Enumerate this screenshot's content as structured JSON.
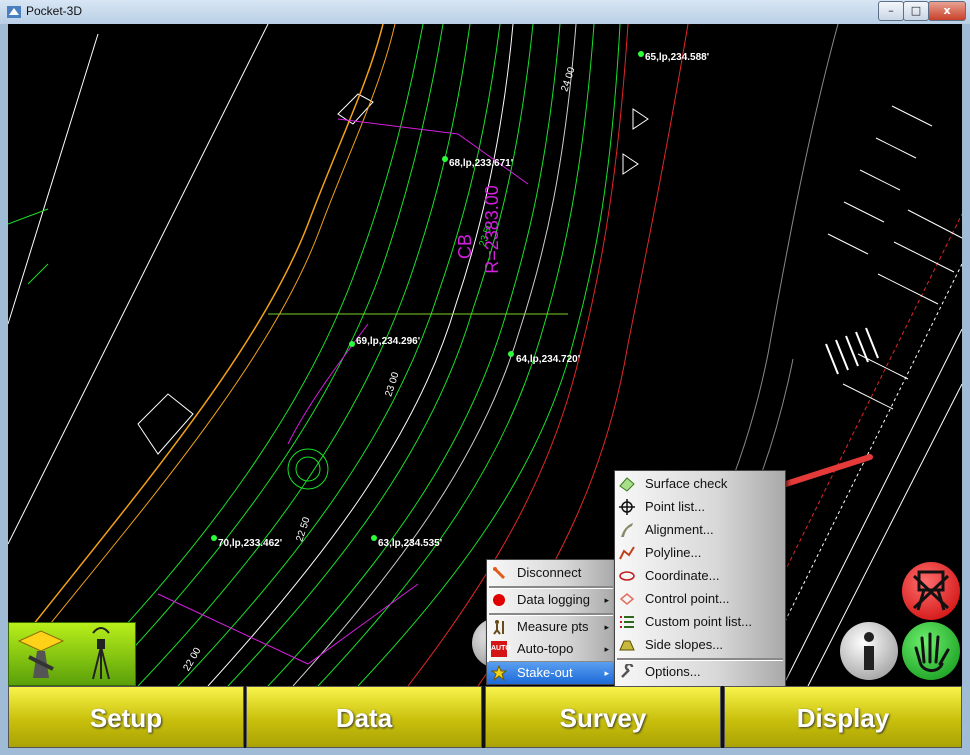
{
  "window": {
    "title": "Pocket-3D",
    "caption_min": "–",
    "caption_max": "□",
    "caption_close": "x"
  },
  "map": {
    "points": [
      "65,lp,234.588'",
      "68,lp,233.671'",
      "69,lp,234.296'",
      "64,lp,234.720'",
      "70,lp,233.462'",
      "63,lp,234.535'"
    ],
    "stations": [
      "24 00",
      "23 50",
      "23 00",
      "22 50",
      "22 00"
    ],
    "curve_label_1": "CB",
    "curve_label_2": "R=2383.00"
  },
  "survey_menu": {
    "items": [
      {
        "label": "Disconnect",
        "icon": "disconnect-icon",
        "submenu": false
      },
      {
        "label": "Data logging",
        "icon": "red-dot-icon",
        "submenu": true
      },
      {
        "label": "Measure pts",
        "icon": "surveyor-icon",
        "submenu": true
      },
      {
        "label": "Auto-topo",
        "icon": "auto-icon",
        "submenu": true
      },
      {
        "label": "Stake-out",
        "icon": "stakeout-icon",
        "submenu": true,
        "selected": true
      }
    ],
    "auto_badge": "AUTO",
    "arrow": "▸"
  },
  "stakeout_menu": {
    "items": [
      {
        "label": "Surface check",
        "icon": "surface-icon"
      },
      {
        "label": "Point list...",
        "icon": "crosshair-icon"
      },
      {
        "label": "Alignment...",
        "icon": "alignment-icon"
      },
      {
        "label": "Polyline...",
        "icon": "polyline-icon"
      },
      {
        "label": "Coordinate...",
        "icon": "coordinate-icon"
      },
      {
        "label": "Control point...",
        "icon": "control-point-icon"
      },
      {
        "label": "Custom point list...",
        "icon": "custom-list-icon"
      },
      {
        "label": "Side slopes...",
        "icon": "side-slopes-icon"
      },
      {
        "label": "Options...",
        "icon": "wrench-icon"
      }
    ]
  },
  "nav": {
    "setup": "Setup",
    "data": "Data",
    "survey": "Survey",
    "display": "Display"
  },
  "colors": {
    "nav_yellow": "#e6de1a",
    "menu_selected": "#1c6ad8",
    "annotation_arrow": "#e53a3a",
    "cad_green": "#19e02a",
    "cad_magenta": "#d51ee0"
  }
}
